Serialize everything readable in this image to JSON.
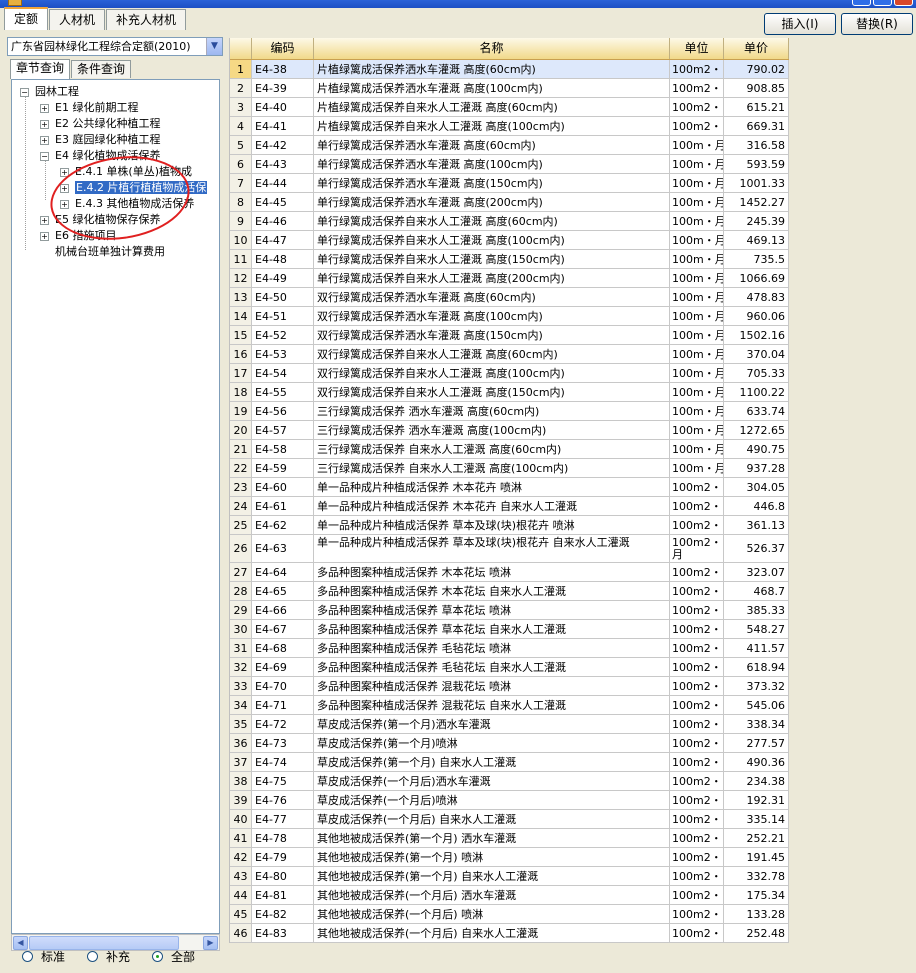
{
  "tabs": [
    "定额",
    "人材机",
    "补充人材机"
  ],
  "buttons": {
    "insert": "插入(I)",
    "replace": "替换(R)"
  },
  "combo": {
    "value": "广东省园林绿化工程综合定额(2010)"
  },
  "subtabs": [
    "章节查询",
    "条件查询"
  ],
  "tree": {
    "root": "园林工程",
    "e1": "E1 绿化前期工程",
    "e2": "E2 公共绿化种植工程",
    "e3": "E3 庭园绿化种植工程",
    "e4": "E4 绿化植物成活保养",
    "e41": "E.4.1 单株(单丛)植物成",
    "e42": "E.4.2 片植行植植物成活保",
    "e43": "E.4.3 其他植物成活保养",
    "e5": "E5 绿化植物保存保养",
    "e6": "E6 措施项目",
    "other": "机械台班单独计算费用"
  },
  "radios": [
    "标准",
    "补充",
    "全部"
  ],
  "radio_selected": "全部",
  "columns": {
    "num": "",
    "code": "编码",
    "name": "名称",
    "unit": "单位",
    "price": "单价"
  },
  "rows": [
    {
      "n": "1",
      "code": "E4-38",
      "name": "片植绿篱成活保养洒水车灌溉 高度(60cm内)",
      "unit": "100m2・",
      "price": "790.02"
    },
    {
      "n": "2",
      "code": "E4-39",
      "name": "片植绿篱成活保养洒水车灌溉 高度(100cm内)",
      "unit": "100m2・",
      "price": "908.85"
    },
    {
      "n": "3",
      "code": "E4-40",
      "name": "片植绿篱成活保养自来水人工灌溉 高度(60cm内)",
      "unit": "100m2・",
      "price": "615.21"
    },
    {
      "n": "4",
      "code": "E4-41",
      "name": "片植绿篱成活保养自来水人工灌溉 高度(100cm内)",
      "unit": "100m2・",
      "price": "669.31"
    },
    {
      "n": "5",
      "code": "E4-42",
      "name": "单行绿篱成活保养洒水车灌溉 高度(60cm内)",
      "unit": "100m・月",
      "price": "316.58"
    },
    {
      "n": "6",
      "code": "E4-43",
      "name": "单行绿篱成活保养洒水车灌溉 高度(100cm内)",
      "unit": "100m・月",
      "price": "593.59"
    },
    {
      "n": "7",
      "code": "E4-44",
      "name": "单行绿篱成活保养洒水车灌溉 高度(150cm内)",
      "unit": "100m・月",
      "price": "1001.33"
    },
    {
      "n": "8",
      "code": "E4-45",
      "name": "单行绿篱成活保养洒水车灌溉 高度(200cm内)",
      "unit": "100m・月",
      "price": "1452.27"
    },
    {
      "n": "9",
      "code": "E4-46",
      "name": "单行绿篱成活保养自来水人工灌溉 高度(60cm内)",
      "unit": "100m・月",
      "price": "245.39"
    },
    {
      "n": "10",
      "code": "E4-47",
      "name": "单行绿篱成活保养自来水人工灌溉 高度(100cm内)",
      "unit": "100m・月",
      "price": "469.13"
    },
    {
      "n": "11",
      "code": "E4-48",
      "name": "单行绿篱成活保养自来水人工灌溉 高度(150cm内)",
      "unit": "100m・月",
      "price": "735.5"
    },
    {
      "n": "12",
      "code": "E4-49",
      "name": "单行绿篱成活保养自来水人工灌溉 高度(200cm内)",
      "unit": "100m・月",
      "price": "1066.69"
    },
    {
      "n": "13",
      "code": "E4-50",
      "name": "双行绿篱成活保养洒水车灌溉 高度(60cm内)",
      "unit": "100m・月",
      "price": "478.83"
    },
    {
      "n": "14",
      "code": "E4-51",
      "name": "双行绿篱成活保养洒水车灌溉 高度(100cm内)",
      "unit": "100m・月",
      "price": "960.06"
    },
    {
      "n": "15",
      "code": "E4-52",
      "name": "双行绿篱成活保养洒水车灌溉 高度(150cm内)",
      "unit": "100m・月",
      "price": "1502.16"
    },
    {
      "n": "16",
      "code": "E4-53",
      "name": "双行绿篱成活保养自来水人工灌溉 高度(60cm内)",
      "unit": "100m・月",
      "price": "370.04"
    },
    {
      "n": "17",
      "code": "E4-54",
      "name": "双行绿篱成活保养自来水人工灌溉 高度(100cm内)",
      "unit": "100m・月",
      "price": "705.33"
    },
    {
      "n": "18",
      "code": "E4-55",
      "name": "双行绿篱成活保养自来水人工灌溉 高度(150cm内)",
      "unit": "100m・月",
      "price": "1100.22"
    },
    {
      "n": "19",
      "code": "E4-56",
      "name": "三行绿篱成活保养 洒水车灌溉 高度(60cm内)",
      "unit": "100m・月",
      "price": "633.74"
    },
    {
      "n": "20",
      "code": "E4-57",
      "name": "三行绿篱成活保养 洒水车灌溉 高度(100cm内)",
      "unit": "100m・月",
      "price": "1272.65"
    },
    {
      "n": "21",
      "code": "E4-58",
      "name": "三行绿篱成活保养 自来水人工灌溉 高度(60cm内)",
      "unit": "100m・月",
      "price": "490.75"
    },
    {
      "n": "22",
      "code": "E4-59",
      "name": "三行绿篱成活保养 自来水人工灌溉 高度(100cm内)",
      "unit": "100m・月",
      "price": "937.28"
    },
    {
      "n": "23",
      "code": "E4-60",
      "name": "单一品种成片种植成活保养   木本花卉 喷淋",
      "unit": "100m2・",
      "price": "304.05"
    },
    {
      "n": "24",
      "code": "E4-61",
      "name": "单一品种成片种植成活保养   木本花卉 自来水人工灌溉",
      "unit": "100m2・",
      "price": "446.8"
    },
    {
      "n": "25",
      "code": "E4-62",
      "name": "单一品种成片种植成活保养   草本及球(块)根花卉 喷淋",
      "unit": "100m2・",
      "price": "361.13"
    },
    {
      "n": "26",
      "code": "E4-63",
      "name": "单一品种成片种植成活保养   草本及球(块)根花卉 自来水人工灌溉",
      "unit": "100m2・月",
      "price": "526.37"
    },
    {
      "n": "27",
      "code": "E4-64",
      "name": "多品种图案种植成活保养 木本花坛 喷淋",
      "unit": "100m2・",
      "price": "323.07"
    },
    {
      "n": "28",
      "code": "E4-65",
      "name": "多品种图案种植成活保养 木本花坛 自来水人工灌溉",
      "unit": "100m2・",
      "price": "468.7"
    },
    {
      "n": "29",
      "code": "E4-66",
      "name": "多品种图案种植成活保养 草本花坛 喷淋",
      "unit": "100m2・",
      "price": "385.33"
    },
    {
      "n": "30",
      "code": "E4-67",
      "name": "多品种图案种植成活保养 草本花坛 自来水人工灌溉",
      "unit": "100m2・",
      "price": "548.27"
    },
    {
      "n": "31",
      "code": "E4-68",
      "name": "多品种图案种植成活保养 毛毡花坛 喷淋",
      "unit": "100m2・",
      "price": "411.57"
    },
    {
      "n": "32",
      "code": "E4-69",
      "name": "多品种图案种植成活保养 毛毡花坛 自来水人工灌溉",
      "unit": "100m2・",
      "price": "618.94"
    },
    {
      "n": "33",
      "code": "E4-70",
      "name": "多品种图案种植成活保养 混栽花坛 喷淋",
      "unit": "100m2・",
      "price": "373.32"
    },
    {
      "n": "34",
      "code": "E4-71",
      "name": "多品种图案种植成活保养 混栽花坛 自来水人工灌溉",
      "unit": "100m2・",
      "price": "545.06"
    },
    {
      "n": "35",
      "code": "E4-72",
      "name": "草皮成活保养(第一个月)洒水车灌溉",
      "unit": "100m2・",
      "price": "338.34"
    },
    {
      "n": "36",
      "code": "E4-73",
      "name": "草皮成活保养(第一个月)喷淋",
      "unit": "100m2・",
      "price": "277.57"
    },
    {
      "n": "37",
      "code": "E4-74",
      "name": "草皮成活保养(第一个月) 自来水人工灌溉",
      "unit": "100m2・",
      "price": "490.36"
    },
    {
      "n": "38",
      "code": "E4-75",
      "name": "草皮成活保养(一个月后)洒水车灌溉",
      "unit": "100m2・",
      "price": "234.38"
    },
    {
      "n": "39",
      "code": "E4-76",
      "name": "草皮成活保养(一个月后)喷淋",
      "unit": "100m2・",
      "price": "192.31"
    },
    {
      "n": "40",
      "code": "E4-77",
      "name": "草皮成活保养(一个月后) 自来水人工灌溉",
      "unit": "100m2・",
      "price": "335.14"
    },
    {
      "n": "41",
      "code": "E4-78",
      "name": "其他地被成活保养(第一个月) 洒水车灌溉",
      "unit": "100m2・",
      "price": "252.21"
    },
    {
      "n": "42",
      "code": "E4-79",
      "name": "其他地被成活保养(第一个月) 喷淋",
      "unit": "100m2・",
      "price": "191.45"
    },
    {
      "n": "43",
      "code": "E4-80",
      "name": "其他地被成活保养(第一个月) 自来水人工灌溉",
      "unit": "100m2・",
      "price": "332.78"
    },
    {
      "n": "44",
      "code": "E4-81",
      "name": "其他地被成活保养(一个月后) 洒水车灌溉",
      "unit": "100m2・",
      "price": "175.34"
    },
    {
      "n": "45",
      "code": "E4-82",
      "name": "其他地被成活保养(一个月后) 喷淋",
      "unit": "100m2・",
      "price": "133.28"
    },
    {
      "n": "46",
      "code": "E4-83",
      "name": "其他地被成活保养(一个月后) 自来水人工灌溉",
      "unit": "100m2・",
      "price": "252.48"
    }
  ]
}
